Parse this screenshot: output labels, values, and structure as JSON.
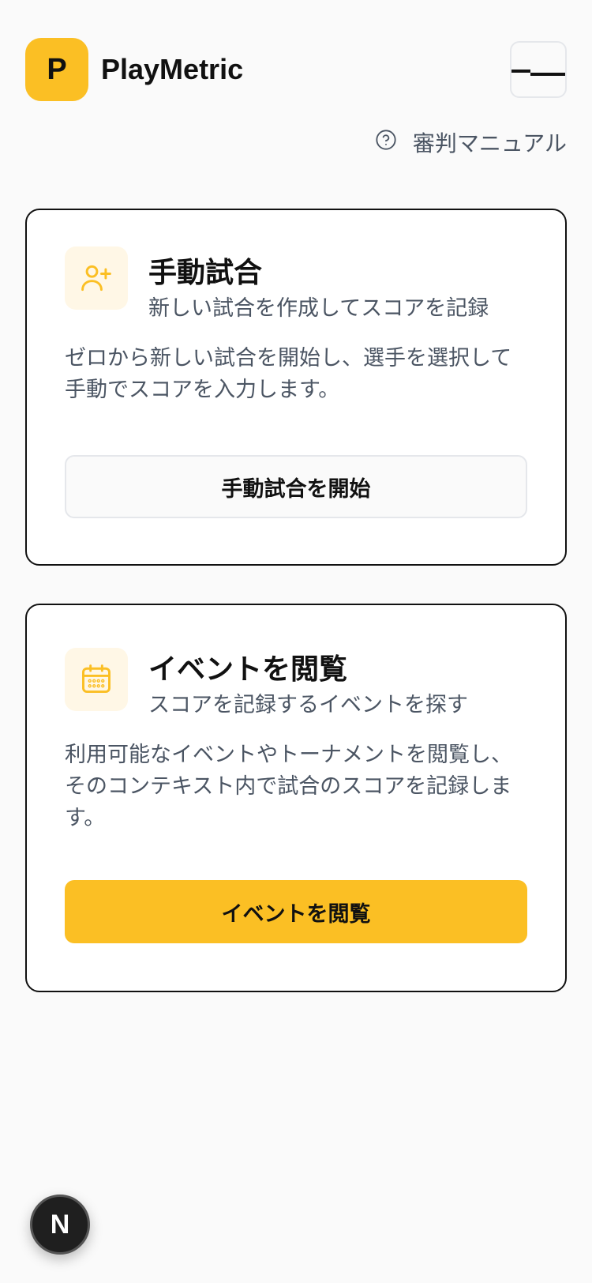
{
  "header": {
    "logo_letter": "P",
    "brand_name": "PlayMetric",
    "menu_icon": "hamburger-icon"
  },
  "help": {
    "label": "審判マニュアル",
    "icon": "question-circle-icon"
  },
  "cards": [
    {
      "icon": "user-plus-icon",
      "title": "手動試合",
      "subtitle": "新しい試合を作成してスコアを記録",
      "description": "ゼロから新しい試合を開始し、選手を選択して手動でスコアを入力します。",
      "button_label": "手動試合を開始"
    },
    {
      "icon": "calendar-icon",
      "title": "イベントを閲覧",
      "subtitle": "スコアを記録するイベントを探す",
      "description": "利用可能なイベントやトーナメントを閲覧し、そのコンテキスト内で試合のスコアを記録します。",
      "button_label": "イベントを閲覧"
    }
  ],
  "dev_badge": {
    "letter": "N"
  },
  "colors": {
    "accent": "#fbbf24",
    "icon_tile_bg": "#fff7e6",
    "muted_text": "#4b5563",
    "border": "#111111"
  }
}
